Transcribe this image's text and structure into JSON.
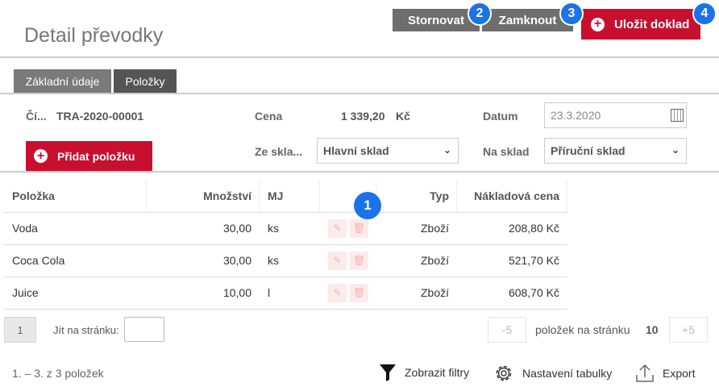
{
  "header": {
    "title": "Detail převodky",
    "cancel_label": "Stornovat",
    "lock_label": "Zamknout",
    "save_label": "Uložit doklad",
    "badges": [
      "1",
      "2",
      "3",
      "4"
    ]
  },
  "tabs": [
    {
      "label": "Základní údaje",
      "active": false
    },
    {
      "label": "Položky",
      "active": true
    }
  ],
  "form": {
    "number_label": "Čí...",
    "number_value": "TRA-2020-00001",
    "price_label": "Cena",
    "price_value": "1 339,20",
    "price_currency": "Kč",
    "date_label": "Datum",
    "date_value": "23.3.2020",
    "from_label": "Ze skla...",
    "from_value": "Hlavní sklad",
    "to_label": "Na sklad",
    "to_value": "Příruční sklad",
    "add_item_label": "Přidat položku"
  },
  "table": {
    "columns": [
      "Položka",
      "Množství",
      "MJ",
      "",
      "Typ",
      "Nákladová cena"
    ],
    "rows": [
      {
        "item": "Voda",
        "qty": "30,00",
        "unit": "ks",
        "type": "Zboží",
        "cost": "208,80 Kč"
      },
      {
        "item": "Coca Cola",
        "qty": "30,00",
        "unit": "ks",
        "type": "Zboží",
        "cost": "521,70 Kč"
      },
      {
        "item": "Juice",
        "qty": "10,00",
        "unit": "l",
        "type": "Zboží",
        "cost": "608,70 Kč"
      }
    ]
  },
  "pagination": {
    "current_page": "1",
    "jump_label": "Jít na stránku:",
    "minus_label": "-5",
    "per_page_label": "položek na stránku",
    "per_page_value": "10",
    "plus_label": "+5",
    "summary": "1. – 3. z 3 položek"
  },
  "toolbar": {
    "filters_label": "Zobrazit filtry",
    "settings_label": "Nastavení tabulky",
    "export_label": "Export"
  },
  "colors": {
    "accent_red": "#c8102e",
    "button_gray": "#6e6e6e",
    "badge_blue": "#1a73e8"
  }
}
